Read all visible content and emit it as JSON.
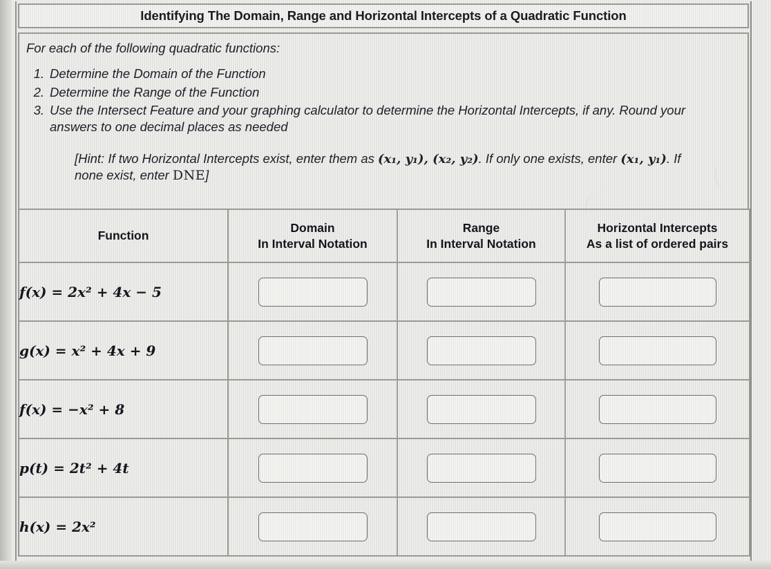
{
  "worksheet": {
    "title": "Identifying The Domain, Range and Horizontal Intercepts of a Quadratic Function",
    "intro": "For each of the following quadratic functions:",
    "steps": [
      {
        "num": "1.",
        "text": "Determine the Domain of the Function"
      },
      {
        "num": "2.",
        "text": "Determine the Range of the Function"
      },
      {
        "num": "3.",
        "text": "Use the Intersect Feature and your graphing calculator to determine the Horizontal Intercepts, if any. Round your answers to one decimal places as needed"
      }
    ],
    "hint": {
      "part1": "[Hint: If two Horizontal Intercepts exist, enter them as ",
      "pair1": "(x₁, y₁), (x₂, y₂)",
      "part2": ". If only one exists, enter ",
      "pair2": "(x₁, y₁)",
      "part3": ". If none exist, enter ",
      "dne": "DNE",
      "part4": "]"
    }
  },
  "table": {
    "headers": [
      {
        "line1": "Function",
        "line2": ""
      },
      {
        "line1": "Domain",
        "line2": "In Interval Notation"
      },
      {
        "line1": "Range",
        "line2": "In Interval Notation"
      },
      {
        "line1": "Horizontal Intercepts",
        "line2": "As a list of ordered pairs"
      }
    ],
    "rows": [
      {
        "function": "f(x) = 2x² + 4x − 5",
        "domain_value": "",
        "domain_placeholder": "",
        "range_value": "",
        "range_placeholder": "",
        "intercepts_value": "",
        "intercepts_placeholder": ""
      },
      {
        "function": "g(x) = x² + 4x + 9",
        "domain_value": "",
        "domain_placeholder": "",
        "range_value": "",
        "range_placeholder": "",
        "intercepts_value": "",
        "intercepts_placeholder": ""
      },
      {
        "function": "f(x) = −x² + 8",
        "domain_value": "",
        "domain_placeholder": "",
        "range_value": "",
        "range_placeholder": "",
        "intercepts_value": "",
        "intercepts_placeholder": ""
      },
      {
        "function": "p(t) = 2t² + 4t",
        "domain_value": "",
        "domain_placeholder": "",
        "range_value": "",
        "range_placeholder": "",
        "intercepts_value": "",
        "intercepts_placeholder": ""
      },
      {
        "function": "h(x) = 2x²",
        "domain_value": "",
        "domain_placeholder": "",
        "range_value": "",
        "range_placeholder": "",
        "intercepts_value": "",
        "intercepts_placeholder": ""
      }
    ]
  },
  "colors": {
    "paper": "#e9e9e6",
    "rule": "#9a9a95",
    "ink": "#16161e",
    "field_border": "#6f6f70"
  }
}
